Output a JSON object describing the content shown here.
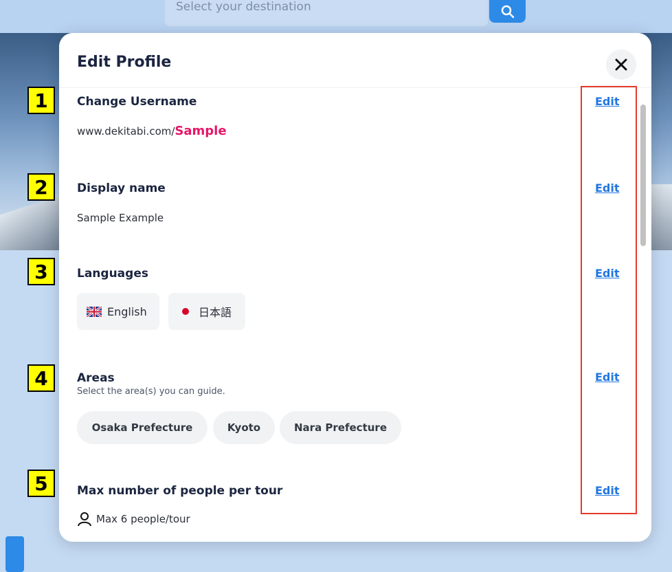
{
  "background": {
    "search_placeholder": "Select your destination"
  },
  "modal": {
    "title": "Edit Profile",
    "close_icon": "close-icon",
    "edit_label": "Edit"
  },
  "sections": {
    "username": {
      "title": "Change Username",
      "url_prefix": "www.dekitabi.com/",
      "username": "Sample"
    },
    "display_name": {
      "title": "Display name",
      "value": "Sample Example"
    },
    "languages": {
      "title": "Languages",
      "items": [
        "English",
        "日本語"
      ]
    },
    "areas": {
      "title": "Areas",
      "subtitle": "Select the area(s) you can guide.",
      "items": [
        "Osaka Prefecture",
        "Kyoto",
        "Nara Prefecture"
      ]
    },
    "max_people": {
      "title": "Max number of people per tour",
      "value": "Max 6 people/tour"
    }
  },
  "annotations": {
    "badges": [
      "1",
      "2",
      "3",
      "4",
      "5"
    ]
  },
  "colors": {
    "accent": "#e8166a",
    "link": "#2176e0",
    "badge": "#ffff00",
    "highlight_box": "#e53a2a",
    "primary_button": "#2d8ae6"
  }
}
